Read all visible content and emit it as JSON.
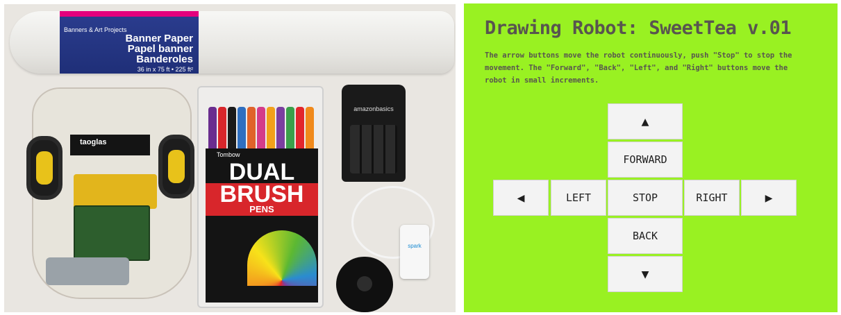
{
  "photo": {
    "paper_label": {
      "line1": "Banners & Art Projects",
      "line2": "Banner Paper",
      "line3": "Papel banner",
      "line4": "Banderoles",
      "size": "36 in x 75 ft • 225 ft²"
    },
    "antenna_brand": "taoglas",
    "markers": {
      "brand": "Tombow",
      "line1": "DUAL",
      "line2": "BRUSH",
      "line3": "PENS",
      "cap_colors": [
        "#6a2d8f",
        "#d8262b",
        "#1a1a1a",
        "#2f6fc0",
        "#e0632a",
        "#d43c8a",
        "#f2a11b",
        "#7b3fa0",
        "#3aa04a",
        "#e2262c",
        "#f08a1c"
      ]
    },
    "charger_brand": "amazonbasics",
    "plug_brand": "spark"
  },
  "app": {
    "title": "Drawing Robot: SweetTea v.01",
    "instructions": "The arrow buttons move the robot continuously, push \"Stop\" to stop the movement. The \"Forward\", \"Back\", \"Left\", and \"Right\" buttons move the robot in small increments.",
    "colors": {
      "background": "#99f122",
      "text": "#58554f",
      "button": "#f3f3f3"
    },
    "controls": {
      "up_arrow": "▲",
      "forward": "FORWARD",
      "left_arrow": "◀",
      "left": "LEFT",
      "stop": "STOP",
      "right": "RIGHT",
      "right_arrow": "▶",
      "back": "BACK",
      "down_arrow": "▼"
    }
  }
}
